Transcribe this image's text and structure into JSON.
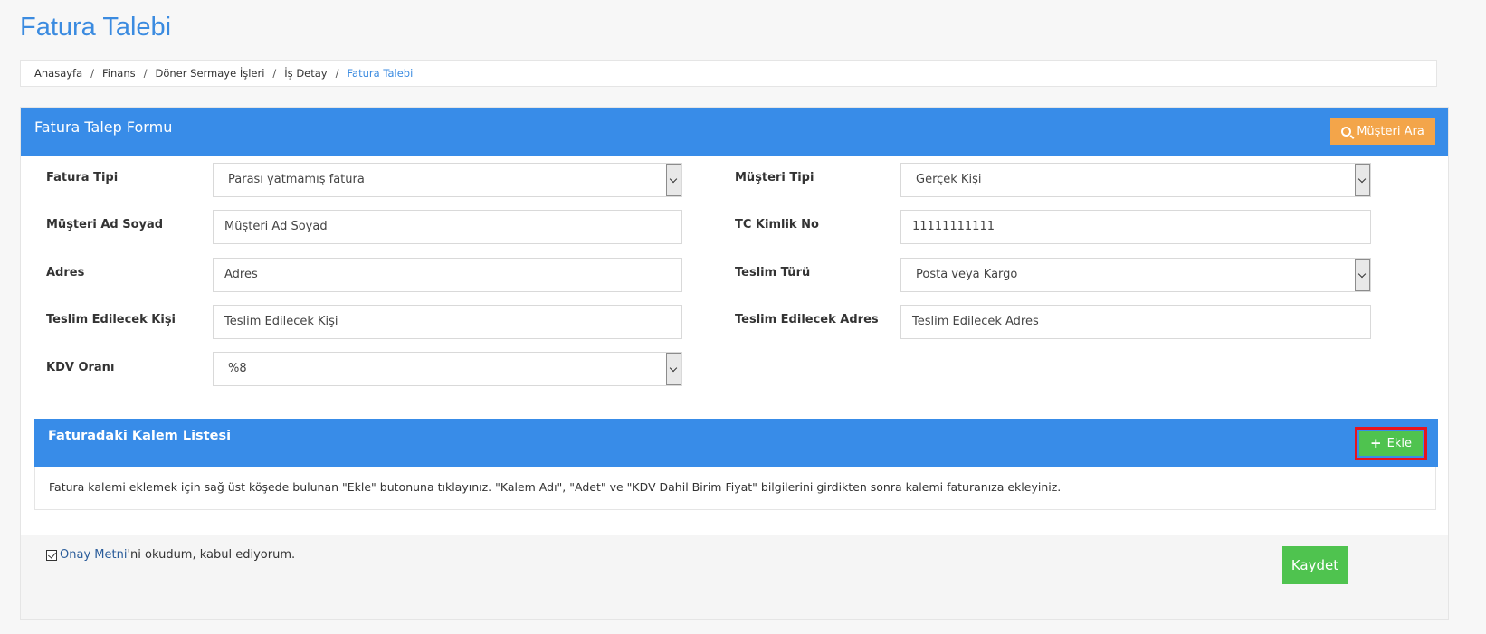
{
  "page": {
    "title": "Fatura Talebi"
  },
  "breadcrumb": {
    "items": [
      "Anasayfa",
      "Finans",
      "Döner Sermaye İşleri",
      "İş Detay"
    ],
    "active": "Fatura Talebi",
    "separator": "/"
  },
  "form": {
    "title": "Fatura Talep Formu",
    "search_button": "Müşteri Ara",
    "fields": {
      "fatura_tipi": {
        "label": "Fatura Tipi",
        "value": "Parası yatmamış fatura"
      },
      "musteri_tipi": {
        "label": "Müşteri Tipi",
        "value": "Gerçek Kişi"
      },
      "musteri_ad_soyad": {
        "label": "Müşteri Ad Soyad",
        "value": "Müşteri Ad Soyad"
      },
      "tc_kimlik_no": {
        "label": "TC Kimlik No",
        "value": "11111111111"
      },
      "adres": {
        "label": "Adres",
        "value": "Adres"
      },
      "teslim_turu": {
        "label": "Teslim Türü",
        "value": "Posta veya Kargo"
      },
      "teslim_edilecek_kisi": {
        "label": "Teslim Edilecek Kişi",
        "value": "Teslim Edilecek Kişi"
      },
      "teslim_edilecek_adres": {
        "label": "Teslim Edilecek Adres",
        "value": "Teslim Edilecek Adres"
      },
      "kdv_orani": {
        "label": "KDV Oranı",
        "value": "%8"
      }
    }
  },
  "items_panel": {
    "title": "Faturadaki Kalem Listesi",
    "add_button": "Ekle",
    "info": "Fatura kalemi eklemek için sağ üst köşede bulunan \"Ekle\" butonuna tıklayınız. \"Kalem Adı\", \"Adet\" ve \"KDV Dahil Birim Fiyat\" bilgilerini girdikten sonra kalemi faturanıza ekleyiniz."
  },
  "footer": {
    "consent_link": "Onay Metni",
    "consent_rest": "'ni okudum, kabul ediyorum.",
    "save_button": "Kaydet"
  },
  "colors": {
    "header_blue": "#388ce8",
    "title_blue": "#3b8be0",
    "search_orange": "#f3a54a",
    "add_green": "#4fc34f",
    "highlight_red": "#e8141c"
  }
}
